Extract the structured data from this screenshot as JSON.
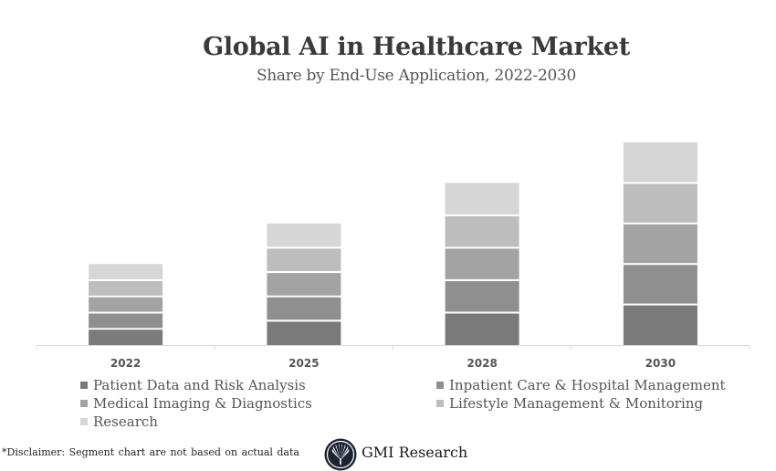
{
  "header": {
    "title": "Global AI in Healthcare Market",
    "subtitle": "Share by End-Use Application, 2022-2030"
  },
  "chart_data": {
    "type": "bar",
    "stacked": true,
    "title": "Global AI in Healthcare Market",
    "subtitle": "Share by End-Use Application, 2022-2030",
    "xlabel": "",
    "ylabel": "",
    "categories": [
      "2022",
      "2025",
      "2028",
      "2030"
    ],
    "ylim": [
      0,
      25
    ],
    "grid": false,
    "y_axis_visible": false,
    "legend_position": "bottom",
    "series": [
      {
        "name": "Patient Data and Risk Analysis",
        "color": "#7a7a7a",
        "values": [
          2,
          3,
          4,
          5
        ]
      },
      {
        "name": "Inpatient Care & Hospital Management",
        "color": "#8f8f8f",
        "values": [
          2,
          3,
          4,
          5
        ]
      },
      {
        "name": "Medical Imaging & Diagnostics",
        "color": "#a3a3a3",
        "values": [
          2,
          3,
          4,
          5
        ]
      },
      {
        "name": "Lifestyle Management & Monitoring",
        "color": "#bdbdbd",
        "values": [
          2,
          3,
          4,
          5
        ]
      },
      {
        "name": "Research",
        "color": "#d6d6d6",
        "values": [
          2,
          3,
          4,
          5
        ]
      }
    ]
  },
  "legend": {
    "items": [
      {
        "label": "Patient Data and Risk Analysis",
        "color": "#7a7a7a"
      },
      {
        "label": "Inpatient Care & Hospital Management",
        "color": "#8f8f8f"
      },
      {
        "label": "Medical Imaging & Diagnostics",
        "color": "#a3a3a3"
      },
      {
        "label": "Lifestyle Management & Monitoring",
        "color": "#bdbdbd"
      },
      {
        "label": "Research",
        "color": "#d6d6d6"
      }
    ]
  },
  "footer": {
    "disclaimer": "*Disclaimer:  Segment chart are not based on actual data",
    "brand": "GMI Research",
    "logo_icon": "fan-logo-icon",
    "logo_color": "#1c2333"
  }
}
